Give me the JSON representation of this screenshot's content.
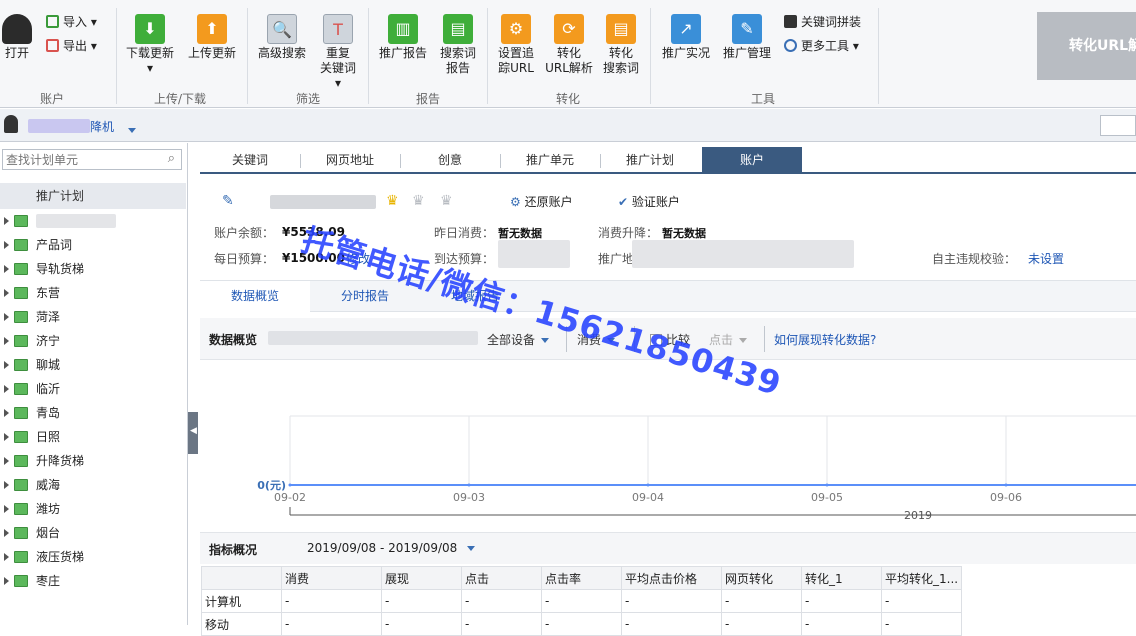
{
  "ribbon": {
    "open": "打开",
    "import": "导入",
    "export": "导出",
    "download": "下载更新",
    "upload": "上传更新",
    "adv_search": "高级搜索",
    "dup_keywords": [
      "重复",
      "关键词"
    ],
    "promo_report": "推广报告",
    "search_report": [
      "搜索词",
      "报告"
    ],
    "set_tracking": [
      "设置追",
      "踪URL"
    ],
    "convert_url": [
      "转化",
      "URL解析"
    ],
    "convert_search": [
      "转化",
      "搜索词"
    ],
    "promo_live": "推广实况",
    "promo_manage": "推广管理",
    "keyword_combine": "关键词拼装",
    "more_tools": "更多工具",
    "groups": {
      "account": "账户",
      "updown": "上传/下载",
      "filter": "筛选",
      "report": "报告",
      "convert": "转化",
      "tools": "工具"
    },
    "banner": "转化URL解"
  },
  "account_bar": {
    "name_suffix": "降机"
  },
  "sidebar": {
    "search_placeholder": "查找计划单元",
    "title": "推广计划",
    "items": [
      "产品词",
      "导轨货梯",
      "东营",
      "菏泽",
      "济宁",
      "聊城",
      "临沂",
      "青岛",
      "日照",
      "升降货梯",
      "威海",
      "潍坊",
      "烟台",
      "液压货梯",
      "枣庄"
    ]
  },
  "tabs": [
    "关键词",
    "网页地址",
    "创意",
    "推广单元",
    "推广计划",
    "账户"
  ],
  "account": {
    "restore": "还原账户",
    "verify": "验证账户",
    "balance_label": "账户余额：",
    "balance": "¥5538.09",
    "daily_budget_label": "每日预算：",
    "daily_budget": "¥1500.00",
    "modify": "修改",
    "yesterday_label": "昨日消费：",
    "yesterday": "暂无数据",
    "reach_budget_label": "到达预算：",
    "change_label": "消费升降：",
    "change": "暂无数据",
    "region_label": "推广地",
    "compliance_label": "自主违规校验：",
    "compliance": "未设置"
  },
  "subtabs": [
    "数据概览",
    "分时报告",
    "地域报告"
  ],
  "overview": {
    "title": "数据概览",
    "device": "全部设备",
    "metric": "消费",
    "compare": "比较",
    "compare_metric": "点击",
    "help_link": "如何展现转化数据?"
  },
  "chart_data": {
    "type": "line",
    "x": [
      "09-02",
      "09-03",
      "09-04",
      "09-05",
      "09-06"
    ],
    "xlabel": "2019",
    "series": [
      {
        "values": [
          0,
          0,
          0,
          0,
          0
        ]
      }
    ],
    "ylabel": "0(元)",
    "colors": {
      "line": "#5b8ff9"
    }
  },
  "metrics": {
    "title": "指标概况",
    "date_range": "2019/09/08 - 2019/09/08",
    "headers": [
      "",
      "消费",
      "展现",
      "点击",
      "点击率",
      "平均点击价格",
      "网页转化",
      "转化_1",
      "平均转化_1..."
    ],
    "rows": [
      [
        "计算机",
        "-",
        "-",
        "-",
        "-",
        "-",
        "-",
        "-",
        "-"
      ],
      [
        "移动",
        "-",
        "-",
        "-",
        "-",
        "-",
        "-",
        "-",
        "-"
      ]
    ]
  },
  "watermark": "托管电话/微信：15621850439"
}
